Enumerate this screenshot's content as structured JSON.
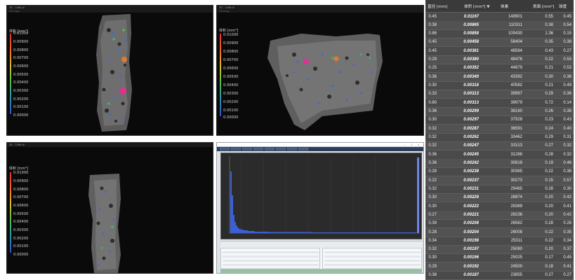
{
  "viewports": [
    {
      "title": "3D - 1/Mtr.dr",
      "subtitle": "TIF Image",
      "legend": {
        "title": "体积 [mm³]",
        "values": [
          "0.01000",
          "0.00900",
          "0.00800",
          "0.00700",
          "0.00600",
          "0.00500",
          "0.00400",
          "0.00300",
          "0.00200",
          "0.00100",
          "0.00000"
        ]
      }
    },
    {
      "title": "3D - 1/Mtr.dr",
      "subtitle": "TIF Image",
      "legend": {
        "title": "体积 [mm³]",
        "values": [
          "0.01000",
          "0.00900",
          "0.00800",
          "0.00700",
          "0.00600",
          "0.00500",
          "0.00400",
          "0.00300",
          "0.00200",
          "0.00100",
          "0.00000"
        ]
      }
    },
    {
      "title": "3D - 1/Mtr.dr",
      "subtitle": "",
      "legend": {
        "title": "体积 [mm³]",
        "values": [
          "0.01000",
          "0.00900",
          "0.00800",
          "0.00700",
          "0.00600",
          "0.00500",
          "0.00400",
          "0.00300",
          "0.00200",
          "0.00100",
          "0.00000"
        ]
      }
    }
  ],
  "histogram_window": {
    "footer": ""
  },
  "table": {
    "columns": [
      "直径 [mm]",
      "体积 [mm³]",
      "体素",
      "表面 [mm²]",
      "球度"
    ],
    "sorted_column_indicator": "▼",
    "rows": [
      [
        "0.45",
        "0.01167",
        "148901",
        "0.55",
        "0.45"
      ],
      [
        "0.38",
        "0.00865",
        "110311",
        "0.38",
        "0.54"
      ],
      [
        "0.86",
        "0.00858",
        "109430",
        "1.36",
        "0.15"
      ],
      [
        "0.45",
        "0.00458",
        "58404",
        "0.35",
        "0.38"
      ],
      [
        "0.45",
        "0.00381",
        "48584",
        "0.43",
        "0.27"
      ],
      [
        "0.29",
        "0.00380",
        "48476",
        "0.22",
        "0.53"
      ],
      [
        "0.25",
        "0.00352",
        "44879",
        "0.21",
        "0.53"
      ],
      [
        "0.36",
        "0.00340",
        "43392",
        "0.30",
        "0.36"
      ],
      [
        "0.30",
        "0.00318",
        "40582",
        "0.21",
        "0.49"
      ],
      [
        "0.33",
        "0.00313",
        "39997",
        "0.29",
        "0.36"
      ],
      [
        "0.80",
        "0.00313",
        "39979",
        "0.72",
        "0.14"
      ],
      [
        "0.36",
        "0.00299",
        "38160",
        "0.26",
        "0.38"
      ],
      [
        "0.30",
        "0.00297",
        "37928",
        "0.23",
        "0.43"
      ],
      [
        "0.32",
        "0.00287",
        "36591",
        "0.24",
        "0.40"
      ],
      [
        "0.32",
        "0.00262",
        "33462",
        "0.29",
        "0.31"
      ],
      [
        "0.32",
        "0.00247",
        "31513",
        "0.27",
        "0.32"
      ],
      [
        "0.36",
        "0.00245",
        "31288",
        "0.28",
        "0.32"
      ],
      [
        "0.36",
        "0.00242",
        "30818",
        "0.19",
        "0.46"
      ],
      [
        "0.28",
        "0.00238",
        "30365",
        "0.22",
        "0.38"
      ],
      [
        "0.22",
        "0.00237",
        "30273",
        "0.15",
        "0.57"
      ],
      [
        "0.32",
        "0.00231",
        "29465",
        "0.28",
        "0.30"
      ],
      [
        "0.30",
        "0.00226",
        "28874",
        "0.20",
        "0.42"
      ],
      [
        "0.30",
        "0.00222",
        "28389",
        "0.20",
        "0.41"
      ],
      [
        "0.27",
        "0.00221",
        "28236",
        "0.20",
        "0.42"
      ],
      [
        "0.39",
        "0.00208",
        "26582",
        "0.28",
        "0.28"
      ],
      [
        "0.28",
        "0.00204",
        "26008",
        "0.22",
        "0.35"
      ],
      [
        "0.34",
        "0.00198",
        "25311",
        "0.22",
        "0.34"
      ],
      [
        "0.32",
        "0.00197",
        "25080",
        "0.20",
        "0.37"
      ],
      [
        "0.30",
        "0.00196",
        "25025",
        "0.17",
        "0.45"
      ],
      [
        "0.29",
        "0.00192",
        "24500",
        "0.18",
        "0.41"
      ],
      [
        "0.38",
        "0.00187",
        "23855",
        "0.27",
        "0.27"
      ]
    ]
  }
}
